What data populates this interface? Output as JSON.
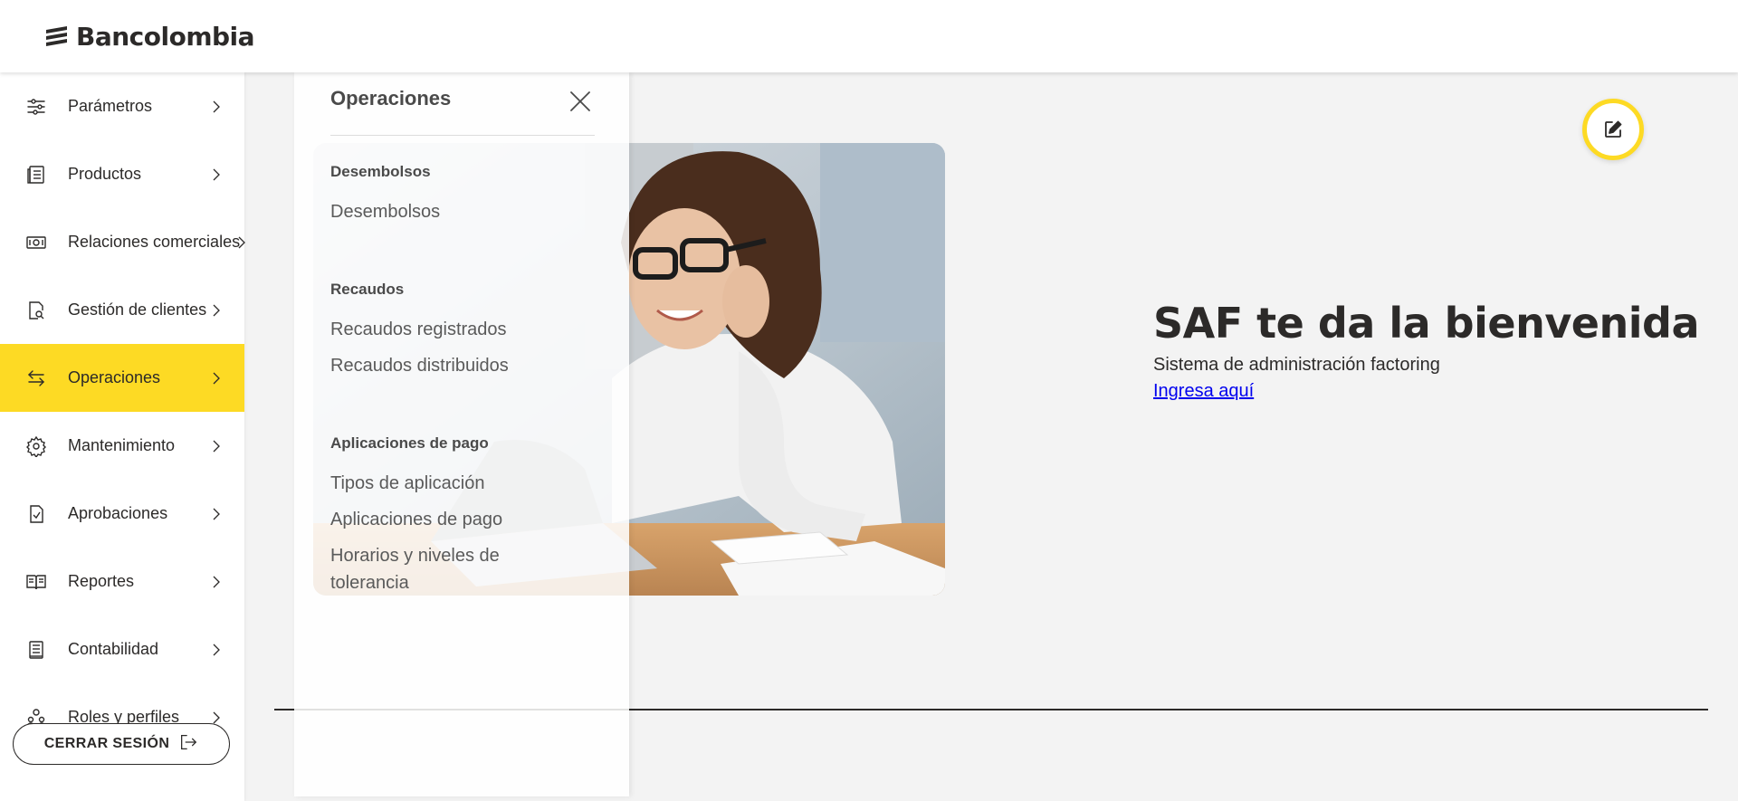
{
  "brand": {
    "name": "Bancolombia"
  },
  "sidebar": {
    "items": [
      {
        "label": "Parámetros",
        "icon": "sliders-icon"
      },
      {
        "label": "Productos",
        "icon": "document-list-icon"
      },
      {
        "label": "Relaciones comerciales",
        "icon": "money-bill-icon"
      },
      {
        "label": "Gestión de clientes",
        "icon": "document-search-icon"
      },
      {
        "label": "Operaciones",
        "icon": "transfer-arrows-icon",
        "active": true
      },
      {
        "label": "Mantenimiento",
        "icon": "gear-icon"
      },
      {
        "label": "Aprobaciones",
        "icon": "document-check-icon"
      },
      {
        "label": "Reportes",
        "icon": "open-book-icon"
      },
      {
        "label": "Contabilidad",
        "icon": "ledger-icon"
      },
      {
        "label": "Roles y perfiles",
        "icon": "users-icon"
      }
    ],
    "logout_label": "CERRAR SESIÓN"
  },
  "flyout": {
    "title": "Operaciones",
    "sections": [
      {
        "title": "Desembolsos",
        "links": [
          "Desembolsos"
        ]
      },
      {
        "title": "Recaudos",
        "links": [
          "Recaudos registrados",
          "Recaudos distribuidos"
        ]
      },
      {
        "title": "Aplicaciones de pago",
        "links": [
          "Tipos de aplicación",
          "Aplicaciones de pago",
          "Horarios y niveles de tolerancia"
        ]
      }
    ]
  },
  "main": {
    "welcome_title": "SAF te da la bienvenida",
    "welcome_subtitle": "Sistema de administración factoring",
    "welcome_link": "Ingresa aquí"
  },
  "colors": {
    "accent": "#fdda24",
    "text": "#2c2a29",
    "link": "#0000ee",
    "background": "#f3f3f3"
  }
}
